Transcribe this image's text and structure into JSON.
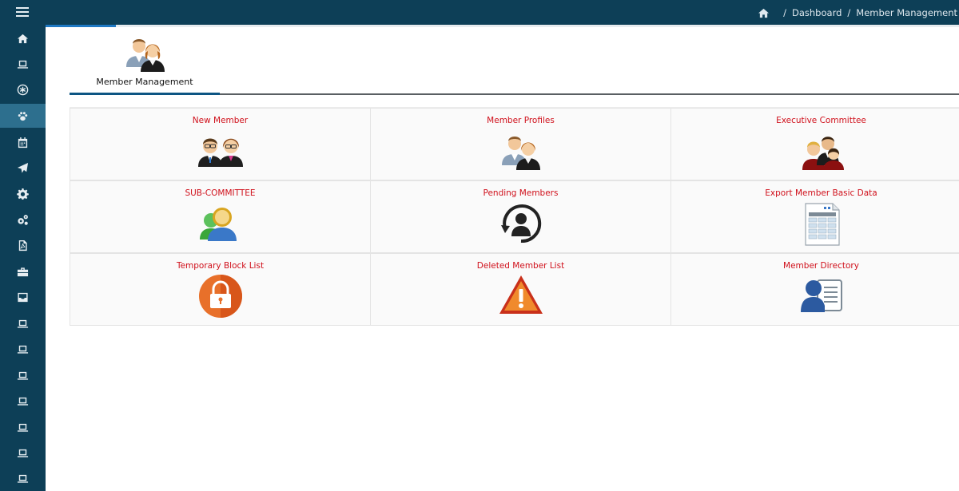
{
  "header": {
    "menu_icon": "hamburger-icon",
    "home_icon": "home-icon",
    "breadcrumb": {
      "separator": "/",
      "dashboard": "Dashboard",
      "current": "Member Management"
    }
  },
  "sidebar": {
    "items": [
      {
        "icon": "home-icon"
      },
      {
        "icon": "laptop-icon"
      },
      {
        "icon": "snowflake-icon"
      },
      {
        "icon": "paw-icon",
        "active": true
      },
      {
        "icon": "calendar-icon"
      },
      {
        "icon": "paper-plane-icon"
      },
      {
        "icon": "cog-icon"
      },
      {
        "icon": "cogs-icon"
      },
      {
        "icon": "pdf-file-icon"
      },
      {
        "icon": "briefcase-icon"
      },
      {
        "icon": "inbox-icon"
      },
      {
        "icon": "laptop-icon"
      },
      {
        "icon": "laptop-icon"
      },
      {
        "icon": "laptop-icon"
      },
      {
        "icon": "laptop-icon"
      },
      {
        "icon": "laptop-icon"
      },
      {
        "icon": "laptop-icon"
      },
      {
        "icon": "laptop-icon"
      }
    ]
  },
  "module_tab": {
    "label": "Member Management",
    "icon": "members-icon"
  },
  "tiles": [
    {
      "label": "New Member",
      "icon": "new-member-icon"
    },
    {
      "label": "Member Profiles",
      "icon": "member-profiles-icon"
    },
    {
      "label": "Executive Committee",
      "icon": "executive-committee-icon"
    },
    {
      "label": "SUB-COMMITTEE",
      "icon": "sub-committee-icon"
    },
    {
      "label": "Pending Members",
      "icon": "pending-members-icon"
    },
    {
      "label": "Export Member Basic Data",
      "icon": "spreadsheet-icon"
    },
    {
      "label": "Temporary Block List",
      "icon": "lock-icon"
    },
    {
      "label": "Deleted Member List",
      "icon": "warning-icon"
    },
    {
      "label": "Member Directory",
      "icon": "directory-icon"
    }
  ],
  "colors": {
    "sidebar_bg": "#0d3f57",
    "active_item": "#2d6f8e",
    "tile_label": "#d0101b",
    "accent": "#1f79c4"
  }
}
